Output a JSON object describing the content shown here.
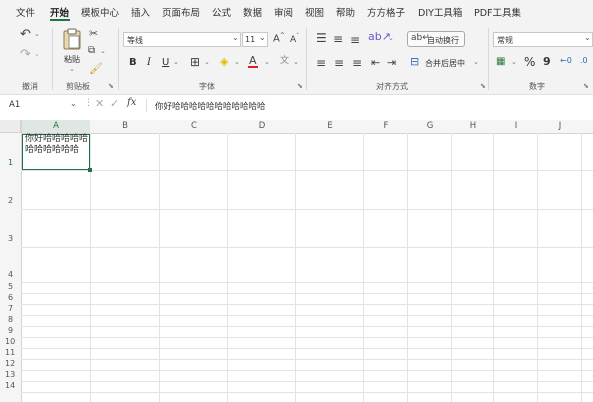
{
  "menu": {
    "items": [
      "文件",
      "开始",
      "模板中心",
      "插入",
      "页面布局",
      "公式",
      "数据",
      "审阅",
      "视图",
      "帮助",
      "方方格子",
      "DIY工具箱",
      "PDF工具集"
    ],
    "active": "开始"
  },
  "ribbon": {
    "undo_group": "撤消",
    "clipboard": {
      "paste_label": "粘贴",
      "group": "剪贴板"
    },
    "font": {
      "name": "等线",
      "size": "11",
      "bold": "B",
      "italic": "I",
      "underline": "U",
      "group": "字体"
    },
    "alignment": {
      "wrap_text": "自动换行",
      "merge_center": "合并后居中",
      "group": "对齐方式"
    },
    "number": {
      "format": "常规",
      "percent": "%",
      "comma": "9",
      "group": "数字"
    }
  },
  "formula_bar": {
    "name_box": "A1",
    "fx_label": "fx",
    "content": "你好哈哈哈哈哈哈哈哈哈哈哈"
  },
  "grid": {
    "columns": [
      "A",
      "B",
      "C",
      "D",
      "E",
      "F",
      "G",
      "H",
      "I",
      "J"
    ],
    "rows": [
      "1",
      "2",
      "3",
      "4",
      "5",
      "6",
      "7",
      "8",
      "9",
      "10",
      "11",
      "12",
      "13",
      "14"
    ],
    "a1_value": "你好哈哈哈哈哈哈哈哈哈哈哈"
  },
  "colors": {
    "accent": "#217346",
    "chrome": "#f3f3f3",
    "gridline": "#e3e3e3"
  }
}
